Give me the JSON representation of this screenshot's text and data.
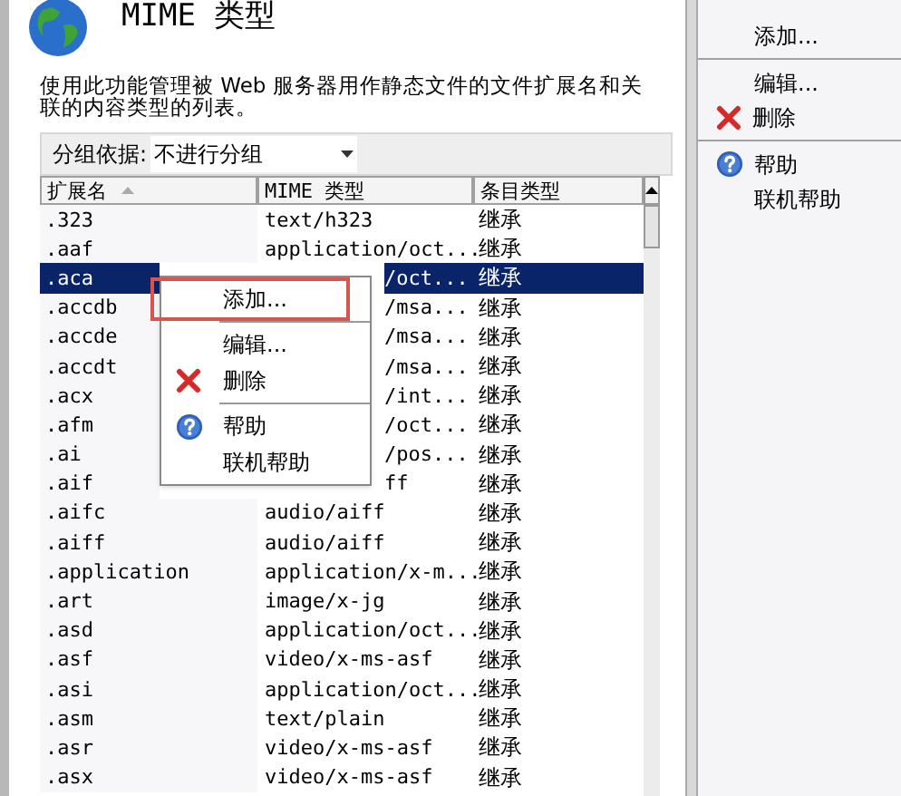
{
  "header": {
    "title": "MIME 类型"
  },
  "description": "使用此功能管理被 Web 服务器用作静态文件的文件扩展名和关联的内容类型的列表。",
  "group_by": {
    "label": "分组依据:",
    "value": "不进行分组"
  },
  "table": {
    "columns": [
      {
        "label": "扩展名",
        "sorted": true
      },
      {
        "label": "MIME 类型",
        "sorted": false
      },
      {
        "label": "条目类型",
        "sorted": false
      }
    ],
    "rows": [
      {
        "ext": ".323",
        "mime": "text/h323",
        "type": "继承",
        "selected": false,
        "covered": false
      },
      {
        "ext": ".aaf",
        "mime": "application/oct...",
        "type": "继承",
        "selected": false,
        "covered": false
      },
      {
        "ext": ".aca",
        "mime": "/oct...",
        "type": "继承",
        "selected": true,
        "covered": true
      },
      {
        "ext": ".accdb",
        "mime": "/msa...",
        "type": "继承",
        "selected": false,
        "covered": true
      },
      {
        "ext": ".accde",
        "mime": "/msa...",
        "type": "继承",
        "selected": false,
        "covered": true
      },
      {
        "ext": ".accdt",
        "mime": "/msa...",
        "type": "继承",
        "selected": false,
        "covered": true
      },
      {
        "ext": ".acx",
        "mime": "/int...",
        "type": "继承",
        "selected": false,
        "covered": true
      },
      {
        "ext": ".afm",
        "mime": "/oct...",
        "type": "继承",
        "selected": false,
        "covered": true
      },
      {
        "ext": ".ai",
        "mime": "/pos...",
        "type": "继承",
        "selected": false,
        "covered": true
      },
      {
        "ext": ".aif",
        "mime": "ff",
        "type": "继承",
        "selected": false,
        "covered": true
      },
      {
        "ext": ".aifc",
        "mime": "audio/aiff",
        "type": "继承",
        "selected": false,
        "covered": false
      },
      {
        "ext": ".aiff",
        "mime": "audio/aiff",
        "type": "继承",
        "selected": false,
        "covered": false
      },
      {
        "ext": ".application",
        "mime": "application/x-m...",
        "type": "继承",
        "selected": false,
        "covered": false
      },
      {
        "ext": ".art",
        "mime": "image/x-jg",
        "type": "继承",
        "selected": false,
        "covered": false
      },
      {
        "ext": ".asd",
        "mime": "application/oct...",
        "type": "继承",
        "selected": false,
        "covered": false
      },
      {
        "ext": ".asf",
        "mime": "video/x-ms-asf",
        "type": "继承",
        "selected": false,
        "covered": false
      },
      {
        "ext": ".asi",
        "mime": "application/oct...",
        "type": "继承",
        "selected": false,
        "covered": false
      },
      {
        "ext": ".asm",
        "mime": "text/plain",
        "type": "继承",
        "selected": false,
        "covered": false
      },
      {
        "ext": ".asr",
        "mime": "video/x-ms-asf",
        "type": "继承",
        "selected": false,
        "covered": false
      },
      {
        "ext": ".asx",
        "mime": "video/x-ms-asf",
        "type": "继承",
        "selected": false,
        "covered": false
      }
    ]
  },
  "context_menu": [
    {
      "label": "添加...",
      "kind": "plain",
      "separator_before": false,
      "highlighted": true
    },
    {
      "label": "编辑...",
      "kind": "plain",
      "separator_before": true,
      "highlighted": false
    },
    {
      "label": "删除",
      "kind": "delete",
      "separator_before": false,
      "highlighted": false
    },
    {
      "label": "帮助",
      "kind": "help",
      "separator_before": true,
      "highlighted": false
    },
    {
      "label": "联机帮助",
      "kind": "plain",
      "separator_before": false,
      "highlighted": false
    }
  ],
  "actions": [
    {
      "label": "添加...",
      "kind": "plain",
      "separator_before": false
    },
    {
      "label": "编辑...",
      "kind": "plain",
      "separator_before": true
    },
    {
      "label": "删除",
      "kind": "delete",
      "separator_before": false
    },
    {
      "label": "帮助",
      "kind": "help",
      "separator_before": true
    },
    {
      "label": "联机帮助",
      "kind": "plain",
      "separator_before": false
    }
  ]
}
